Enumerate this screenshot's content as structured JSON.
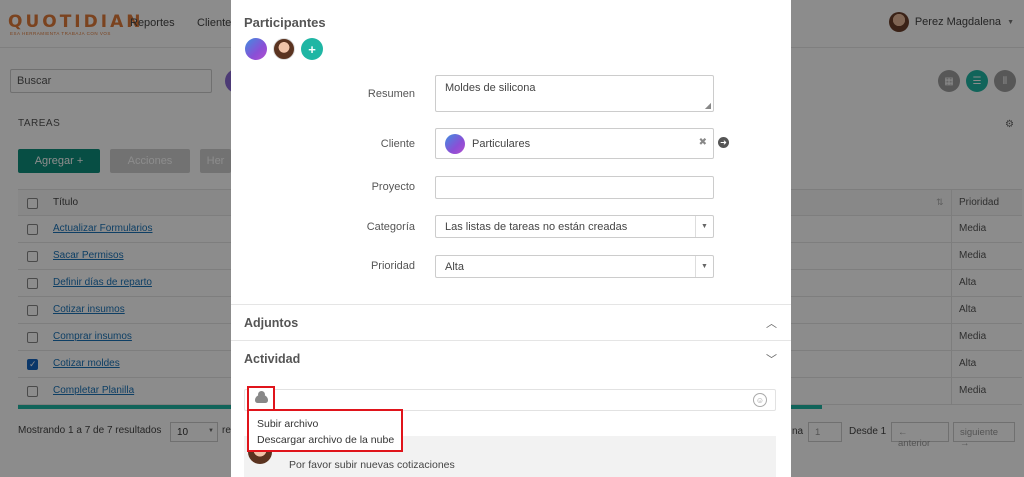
{
  "app": {
    "logo": "QUOTIDIAN",
    "tagline": "ESA HERRAMIENTA TRABAJA CON VOS",
    "nav": [
      "Reportes",
      "Clientes"
    ],
    "user_name": "Perez Magdalena"
  },
  "toolbar": {
    "search_placeholder": "Buscar"
  },
  "tasks": {
    "section_title": "TAREAS",
    "add_button": "Agregar +",
    "actions_button": "Acciones",
    "third_button": "Her",
    "headers": {
      "title": "Título",
      "priority": "Prioridad"
    },
    "rows": [
      {
        "title": "Actualizar Formularios",
        "priority": "Media",
        "checked": false
      },
      {
        "title": "Sacar Permisos",
        "priority": "Media",
        "checked": false
      },
      {
        "title": "Definir días de reparto",
        "priority": "Alta",
        "checked": false
      },
      {
        "title": "Cotizar insumos",
        "priority": "Alta",
        "checked": false
      },
      {
        "title": "Comprar insumos",
        "priority": "Media",
        "checked": false
      },
      {
        "title": "Cotizar moldes",
        "priority": "Alta",
        "checked": true
      },
      {
        "title": "Completar Planilla",
        "priority": "Media",
        "checked": false
      }
    ],
    "footer_text": "Mostrando 1 a 7 de 7 resultados",
    "page_length": "10",
    "page_length_suffix": "re",
    "page_label_prefix": "na",
    "page_number": "1",
    "desde_label": "Desde 1",
    "prev_button": "← anterior",
    "next_button": "siguiente →"
  },
  "modal": {
    "participants_title": "Participantes",
    "add_participant": "+",
    "fields": {
      "resumen_label": "Resumen",
      "resumen_value": "Moldes de silicona",
      "cliente_label": "Cliente",
      "cliente_value": "Particulares",
      "proyecto_label": "Proyecto",
      "proyecto_value": "",
      "categoria_label": "Categoría",
      "categoria_value": "Las listas de tareas no están creadas",
      "prioridad_label": "Prioridad",
      "prioridad_value": "Alta"
    },
    "attachments_title": "Adjuntos",
    "activity_title": "Actividad",
    "upload_menu": [
      "Subir archivo",
      "Descargar archivo de la nube"
    ],
    "feed_comment": "Por favor subir nuevas cotizaciones"
  }
}
